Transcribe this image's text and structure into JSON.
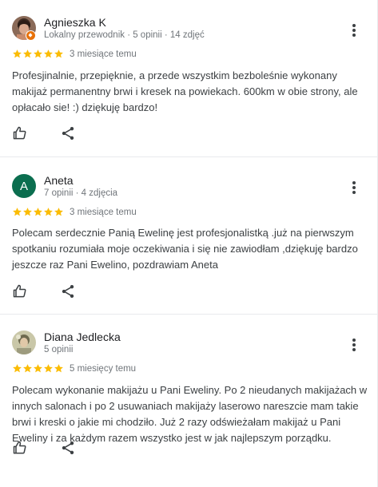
{
  "reviews": [
    {
      "author": "Agnieszka K",
      "meta": "Lokalny przewodnik · 5 opinii · 14 zdjęć",
      "rating": 5,
      "date": "3 miesiące temu",
      "text": "Profesjinalnie, przepięknie, a przede wszystkim bezboleśnie wykonany makijaż permanentny brwi i kresek na powiekach. 600km w obie strony, ale opłacało sie! :) dziękuję bardzo!",
      "avatar": "photo",
      "avatar_color": "#6b4f3f"
    },
    {
      "author": "Aneta",
      "meta": "7 opinii · 4 zdjęcia",
      "rating": 5,
      "date": "3 miesiące temu",
      "text": "Polecam serdecznie Panią Ewelinę jest profesjonalistką .już na pierwszym spotkaniu rozumiała moje oczekiwania i się nie zawiodłam ,dziękuję bardzo jeszcze raz Pani Ewelino, pozdrawiam Aneta",
      "avatar": "letter",
      "avatar_letter": "A",
      "avatar_color": "#0b6e4f"
    },
    {
      "author": "Diana Jedlecka",
      "meta": "5 opinii",
      "rating": 5,
      "date": "5 miesięcy temu",
      "text": "Polecam wykonanie makijażu u Pani Eweliny. Po 2 nieudanych makijażach w innych salonach i po 2 usuwaniach makijaży laserowo nareszcie mam takie brwi i kreski o jakie mi chodziło. Już 2 razy odświeżałam makijaż u Pani Eweliny i za każdym razem wszystko jest w jak najlepszym porządku.",
      "avatar": "photo",
      "avatar_color": "#b7b89a"
    }
  ],
  "colors": {
    "star": "#fbbc04",
    "icon": "#3c4043"
  },
  "icons": {
    "like": "thumb-up-icon",
    "share": "share-icon",
    "more": "more-vert-icon",
    "star": "star-icon"
  }
}
